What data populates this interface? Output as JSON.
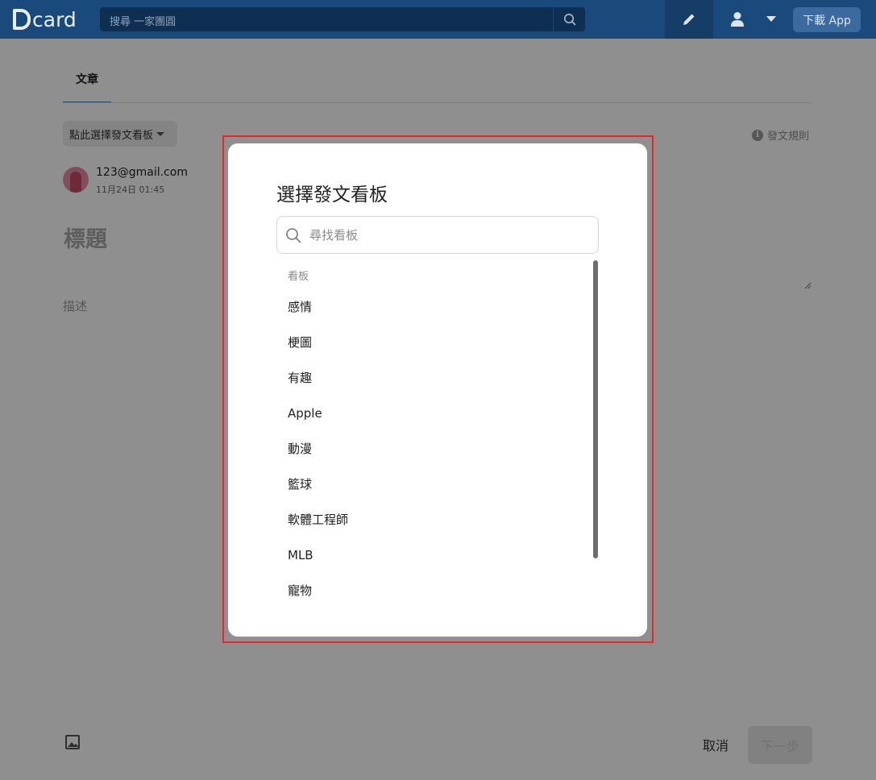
{
  "nav": {
    "logo": "card",
    "search_placeholder": "搜尋 一家團圓",
    "download_label": "下載 App"
  },
  "editor": {
    "tab_label": "文章",
    "board_select_label": "點此選擇發文看板",
    "rules_label": "發文規則",
    "user_email": "123@gmail.com",
    "post_time": "11月24日 01:45",
    "title_placeholder": "標題",
    "description_placeholder": "描述",
    "cancel_label": "取消",
    "next_label": "下一步"
  },
  "modal": {
    "title": "選擇發文看板",
    "search_placeholder": "尋找看板",
    "section_header": "看板",
    "boards": [
      "感情",
      "梗圖",
      "有趣",
      "Apple",
      "動漫",
      "籃球",
      "軟體工程師",
      "MLB",
      "寵物"
    ]
  },
  "colors": {
    "nav_bg": "#1a4a7c",
    "accent": "#3b82c4",
    "highlight_border": "#e8242d"
  }
}
